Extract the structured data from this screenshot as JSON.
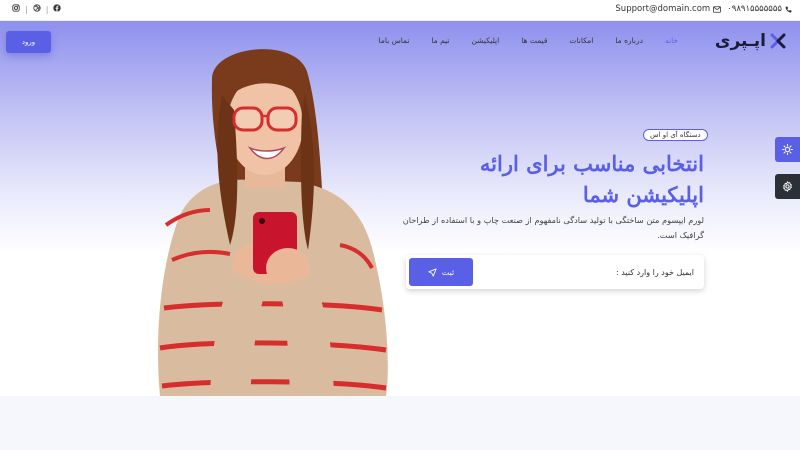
{
  "topbar": {
    "email": "Support@domain.com",
    "phone": "۰۹۸۹۱۵۵۵۵۵۵۵",
    "social_icons": [
      "instagram-icon",
      "dribbble-icon",
      "facebook-icon"
    ]
  },
  "nav": {
    "logo_text": "اپـپری",
    "menu": [
      {
        "label": "خانه",
        "active": true
      },
      {
        "label": "درباره ما"
      },
      {
        "label": "امکانات"
      },
      {
        "label": "قیمت ها"
      },
      {
        "label": "اپلیکیشن"
      },
      {
        "label": "تیم ما"
      },
      {
        "label": "تماس باما"
      }
    ],
    "login_label": "ورود"
  },
  "hero": {
    "badge": "دستگاه آی او اس",
    "headline_line1": "انتخابی مناسب برای ارائه",
    "headline_line2": "اپلیکیشن شما",
    "description": "لورم ایپسوم متن ساختگی با تولید سادگی نامفهوم از صنعت چاپ و با استفاده از طراحان گرافیک است.",
    "email_placeholder": "ایمیل خود را وارد کنید :",
    "submit_label": "ثبت"
  },
  "colors": {
    "accent": "#5a60e6",
    "dark": "#2b2f36"
  }
}
